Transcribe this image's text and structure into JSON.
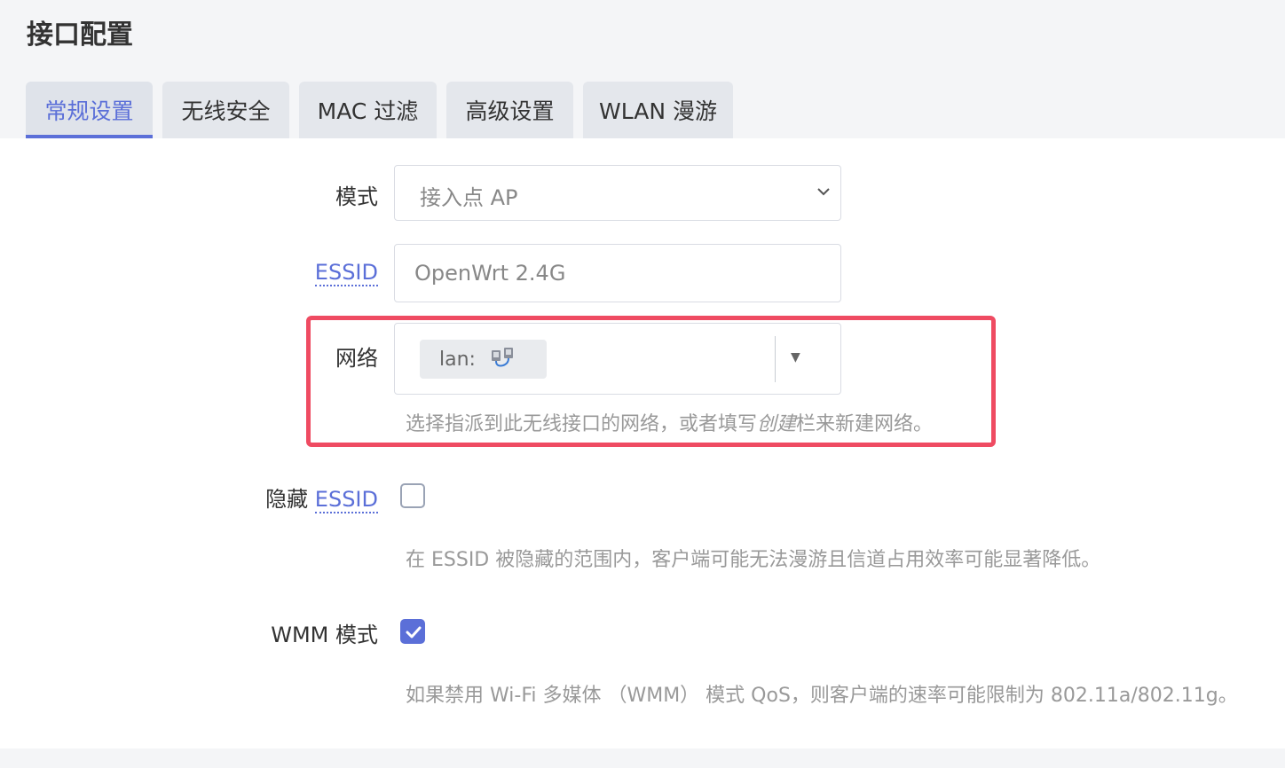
{
  "page_title": "接口配置",
  "tabs": [
    {
      "label": "常规设置",
      "active": true
    },
    {
      "label": "无线安全",
      "active": false
    },
    {
      "label": "MAC 过滤",
      "active": false
    },
    {
      "label": "高级设置",
      "active": false
    },
    {
      "label": "WLAN 漫游",
      "active": false
    }
  ],
  "form": {
    "mode": {
      "label": "模式",
      "value": "接入点 AP",
      "icon": "chevron-down-icon"
    },
    "essid": {
      "label": "ESSID",
      "value": "OpenWrt 2.4G"
    },
    "network": {
      "label": "网络",
      "chip_label": "lan:",
      "chip_icon": "network-interface-icon",
      "dropdown_icon": "triangle-down-icon",
      "description_before": "选择指派到此无线接口的网络，或者填写",
      "description_em": "创建",
      "description_after": "栏来新建网络。"
    },
    "hide_essid": {
      "label_prefix": "隐藏",
      "label_abbr": "ESSID",
      "checked": false,
      "description": "在 ESSID 被隐藏的范围内，客户端可能无法漫游且信道占用效率可能显著降低。"
    },
    "wmm": {
      "label": "WMM 模式",
      "checked": true,
      "description": "如果禁用 Wi-Fi 多媒体 （WMM） 模式 QoS，则客户端的速率可能限制为 802.11a/802.11g。"
    }
  },
  "colors": {
    "accent": "#5b6fd8",
    "highlight": "#ef4b62"
  }
}
